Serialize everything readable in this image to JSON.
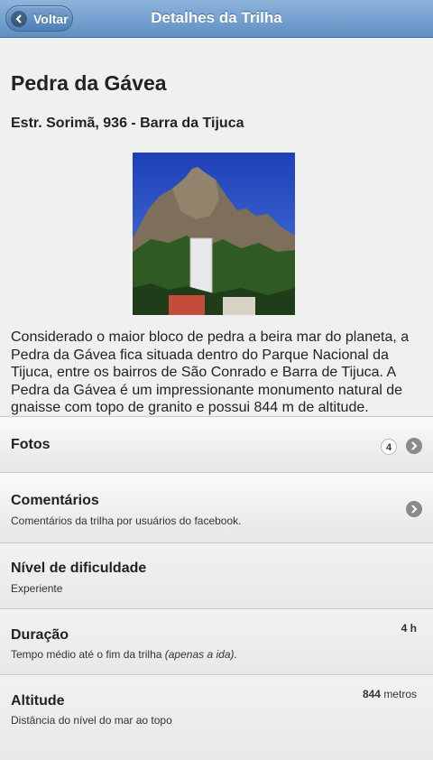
{
  "header": {
    "title": "Detalhes da Trilha",
    "back_label": "Voltar"
  },
  "trail": {
    "name": "Pedra da Gávea",
    "address": "Estr. Sorimã, 936 - Barra da Tijuca",
    "description": "Considerado o maior bloco de pedra a beira mar do planeta, a Pedra da Gávea fica situada dentro do Parque Nacional da Tijuca, entre os bairros de São Conrado e Barra de Tijuca. A Pedra da Gávea é um impressionante monumento natural de gnaisse com topo de granito e possui 844 m de altitude."
  },
  "list": {
    "photos": {
      "title": "Fotos",
      "count": "4"
    },
    "comments": {
      "title": "Comentários",
      "subtitle": "Comentários da trilha por usuários do facebook."
    },
    "difficulty": {
      "title": "Nível de dificuldade",
      "value": "Experiente"
    },
    "duration": {
      "title": "Duração",
      "subtitle": "Tempo médio até o fim da trilha",
      "subtitle_note": "(apenas a ida).",
      "value": "4 h"
    },
    "altitude": {
      "title": "Altitude",
      "subtitle": "Distância do nível do mar ao topo",
      "value": "844",
      "unit": "metros"
    }
  },
  "colors": {
    "header_top": "#8fb4dc",
    "header_bottom": "#5f8fc4",
    "page_bg": "#f0f0f0"
  },
  "icons": {
    "back": "chevron-left-icon",
    "arrow": "chevron-right-icon"
  }
}
